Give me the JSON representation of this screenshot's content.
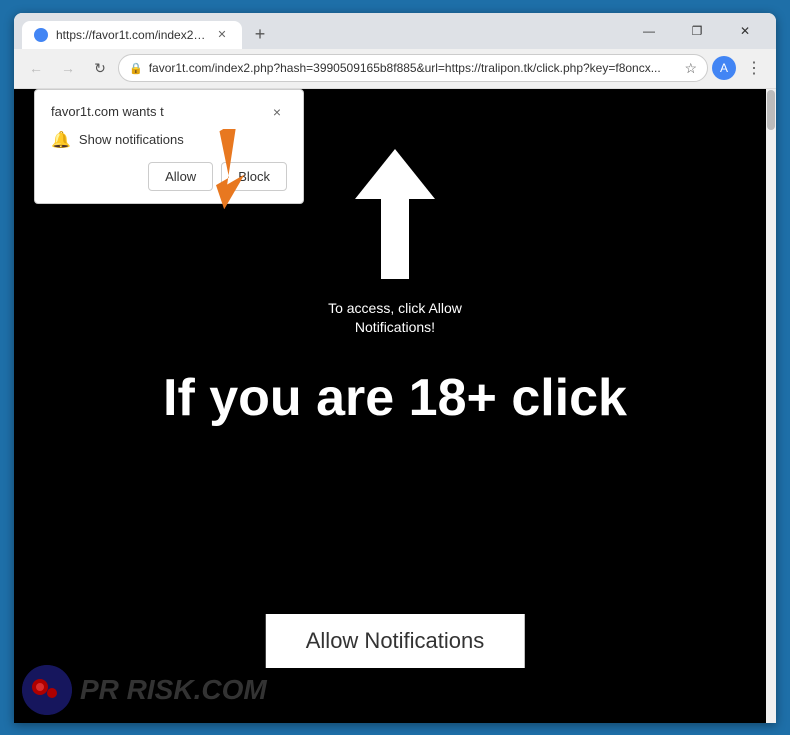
{
  "browser": {
    "tab": {
      "favicon_alt": "favicon",
      "title": "https://favor1t.com/index2.php?..."
    },
    "new_tab_label": "+",
    "window_controls": {
      "minimize": "—",
      "maximize": "❐",
      "close": "✕"
    },
    "nav": {
      "back": "←",
      "forward": "→",
      "reload": "↻",
      "address": "favor1t.com/index2.php?hash=3990509165b8f885&url=https://tralipon.tk/click.php?key=f8oncx...",
      "address_placeholder": "Search or enter address",
      "star": "☆",
      "profile_initial": "A",
      "menu": "⋮"
    }
  },
  "notification_popup": {
    "title": "favor1t.com wants t",
    "close_label": "×",
    "notification_row_label": "Show notifications",
    "allow_button": "Allow",
    "block_button": "Block"
  },
  "page": {
    "access_text": "To access, click Allow\nNotifications!",
    "big_text": "If you are 18+ click",
    "allow_notifications_btn": "Allow Notifications"
  },
  "watermark": {
    "text": "RISK.COM"
  },
  "colors": {
    "browser_bg": "#1e6fa8",
    "page_bg": "#000000",
    "popup_bg": "#ffffff",
    "orange_arrow": "#e87820",
    "allow_btn_bg": "#ffffff"
  }
}
